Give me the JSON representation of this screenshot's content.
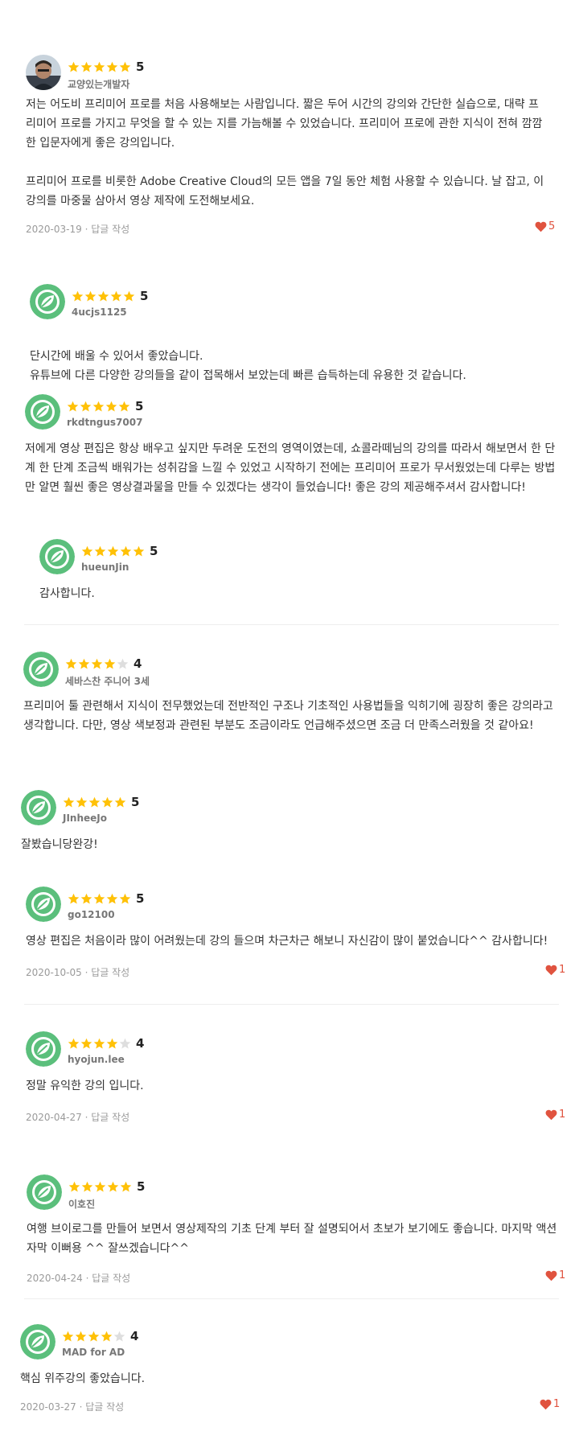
{
  "colors": {
    "star_filled": "#ffc107",
    "star_empty": "#dedede",
    "heart": "#e0533f",
    "avatar_green": "#5bbf7c"
  },
  "reply_label": "· 답글 작성",
  "reviews": [
    {
      "user": "교양있는개발자",
      "score": "5",
      "stars": 5,
      "avatar": "photo",
      "paragraphs": [
        "저는 어도비 프리미어 프로를 처음 사용해보는 사람입니다. 짧은 두어 시간의 강의와 간단한 실습으로, 대략 프리미어 프로를 가지고 무엇을 할 수 있는 지를 가늠해볼 수 있었습니다. 프리미어 프로에 관한 지식이 전혀 깜깜한 입문자에게 좋은 강의입니다.",
        "프리미어 프로를 비롯한 Adobe Creative Cloud의 모든 앱을 7일 동안 체험 사용할 수 있습니다. 날 잡고, 이 강의를 마중물 삼아서 영상 제작에 도전해보세요."
      ],
      "date": "2020-03-19",
      "likes": "5"
    },
    {
      "user": "4ucjs1125",
      "score": "5",
      "stars": 5,
      "paragraphs": [
        "단시간에 배울 수 있어서 좋았습니다.\n유튜브에 다른 다양한 강의들을 같이 접목해서 보았는데 빠른 습득하는데 유용한 것 같습니다."
      ]
    },
    {
      "user": "rkdtngus7007",
      "score": "5",
      "stars": 5,
      "paragraphs": [
        "저에게 영상 편집은 항상 배우고 싶지만 두려운 도전의 영역이였는데, 쇼콜라떼님의 강의를 따라서 해보면서 한 단계 한 단계 조금씩 배워가는 성취감을 느낄 수 있었고 시작하기 전에는 프리미어 프로가 무서웠었는데 다루는 방법만 알면 훨씬 좋은 영상결과물을 만들 수 있겠다는 생각이 들었습니다! 좋은 강의 제공해주셔서 감사합니다!"
      ]
    },
    {
      "user": "hueunJin",
      "score": "5",
      "stars": 5,
      "paragraphs": [
        "감사합니다."
      ]
    },
    {
      "user": "세바스찬 주니어 3세",
      "score": "4",
      "stars": 4,
      "paragraphs": [
        "프리미어 툴 관련해서 지식이 전무했었는데 전반적인 구조나 기초적인 사용법들을 익히기에 굉장히 좋은 강의라고 생각합니다. 다만, 영상 색보정과 관련된 부분도 조금이라도 언급해주셨으면 조금 더 만족스러웠을 것 같아요!"
      ]
    },
    {
      "user": "JInheeJo",
      "score": "5",
      "stars": 5,
      "paragraphs": [
        "잘봤습니당완강!"
      ]
    },
    {
      "user": "go12100",
      "score": "5",
      "stars": 5,
      "paragraphs": [
        "영상 편집은 처음이라 많이 어려웠는데 강의 들으며 차근차근 해보니 자신감이 많이 붙었습니다^^ 감사합니다!"
      ],
      "date": "2020-10-05",
      "likes": "1"
    },
    {
      "user": "hyojun.lee",
      "score": "4",
      "stars": 4,
      "paragraphs": [
        "정말 유익한 강의 입니다."
      ],
      "date": "2020-04-27",
      "likes": "1"
    },
    {
      "user": "이호진",
      "score": "5",
      "stars": 5,
      "paragraphs": [
        "여행 브이로그를 만들어 보면서 영상제작의 기초 단계 부터 잘 설명되어서 초보가 보기에도 좋습니다. 마지막 액션 자막 이뻐용 ^^ 잘쓰겠습니다^^"
      ],
      "date": "2020-04-24",
      "likes": "1"
    },
    {
      "user": "MAD for AD",
      "score": "4",
      "stars": 4,
      "paragraphs": [
        "핵심 위주강의 좋았습니다."
      ],
      "date": "2020-03-27",
      "likes": "1"
    }
  ]
}
